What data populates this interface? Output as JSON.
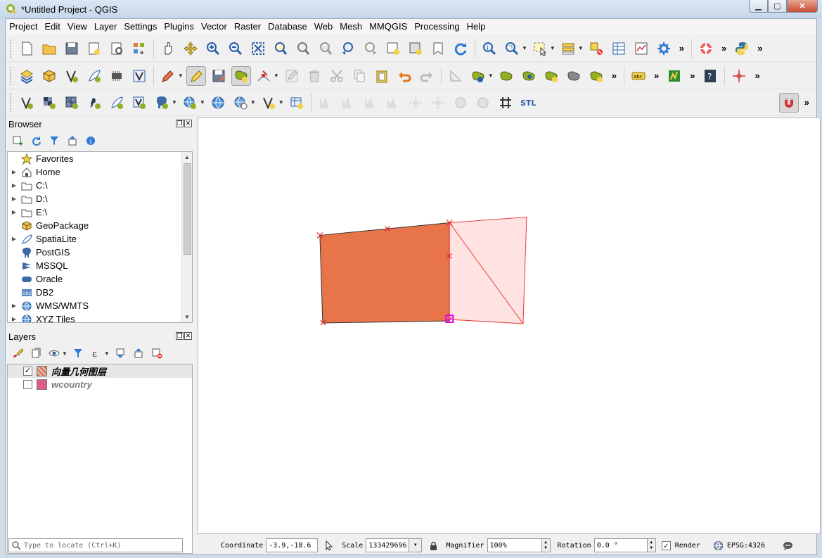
{
  "window": {
    "title": "*Untitled Project - QGIS",
    "minimize": "▁",
    "maximize": "▢",
    "close": "✕"
  },
  "menu": [
    "Project",
    "Edit",
    "View",
    "Layer",
    "Settings",
    "Plugins",
    "Vector",
    "Raster",
    "Database",
    "Web",
    "Mesh",
    "MMQGIS",
    "Processing",
    "Help"
  ],
  "toolbar": {
    "overflow": "»",
    "stl_label": "STL",
    "abc_label": "abc"
  },
  "browser": {
    "title": "Browser",
    "items": [
      {
        "label": "Favorites",
        "expandable": false,
        "icon": "star-icon"
      },
      {
        "label": "Home",
        "expandable": true,
        "icon": "home-icon"
      },
      {
        "label": "C:\\",
        "expandable": true,
        "icon": "folder-icon"
      },
      {
        "label": "D:\\",
        "expandable": true,
        "icon": "folder-icon"
      },
      {
        "label": "E:\\",
        "expandable": true,
        "icon": "folder-icon"
      },
      {
        "label": "GeoPackage",
        "expandable": false,
        "icon": "geopackage-icon"
      },
      {
        "label": "SpatiaLite",
        "expandable": true,
        "icon": "spatialite-icon"
      },
      {
        "label": "PostGIS",
        "expandable": false,
        "icon": "postgis-icon"
      },
      {
        "label": "MSSQL",
        "expandable": false,
        "icon": "mssql-icon"
      },
      {
        "label": "Oracle",
        "expandable": false,
        "icon": "oracle-icon"
      },
      {
        "label": "DB2",
        "expandable": false,
        "icon": "db2-icon"
      },
      {
        "label": "WMS/WMTS",
        "expandable": true,
        "icon": "globe-icon"
      },
      {
        "label": "XYZ Tiles",
        "expandable": true,
        "icon": "globe-icon"
      }
    ]
  },
  "layers": {
    "title": "Layers",
    "items": [
      {
        "name": "向量几何图层",
        "checked": true,
        "color": "#e8744a",
        "editing": true
      },
      {
        "name": "wcountry",
        "checked": false,
        "color": "#e05a8a",
        "editing": false
      }
    ]
  },
  "colors": {
    "polygon_fill": "#e8744a",
    "pending_fill": "#ffe0e0",
    "pending_stroke": "#ee3b3b",
    "vertex_marker": "#e8262e",
    "snap_marker": "#e600e6"
  },
  "status": {
    "locator_placeholder": "Type to locate (Ctrl+K)",
    "coordinate_label": "Coordinate",
    "coordinate_value": "-3.9,-18.6",
    "scale_label": "Scale",
    "scale_value": "133429696",
    "magnifier_label": "Magnifier",
    "magnifier_value": "100%",
    "rotation_label": "Rotation",
    "rotation_value": "0.0 °",
    "render_label": "Render",
    "crs": "EPSG:4326"
  }
}
